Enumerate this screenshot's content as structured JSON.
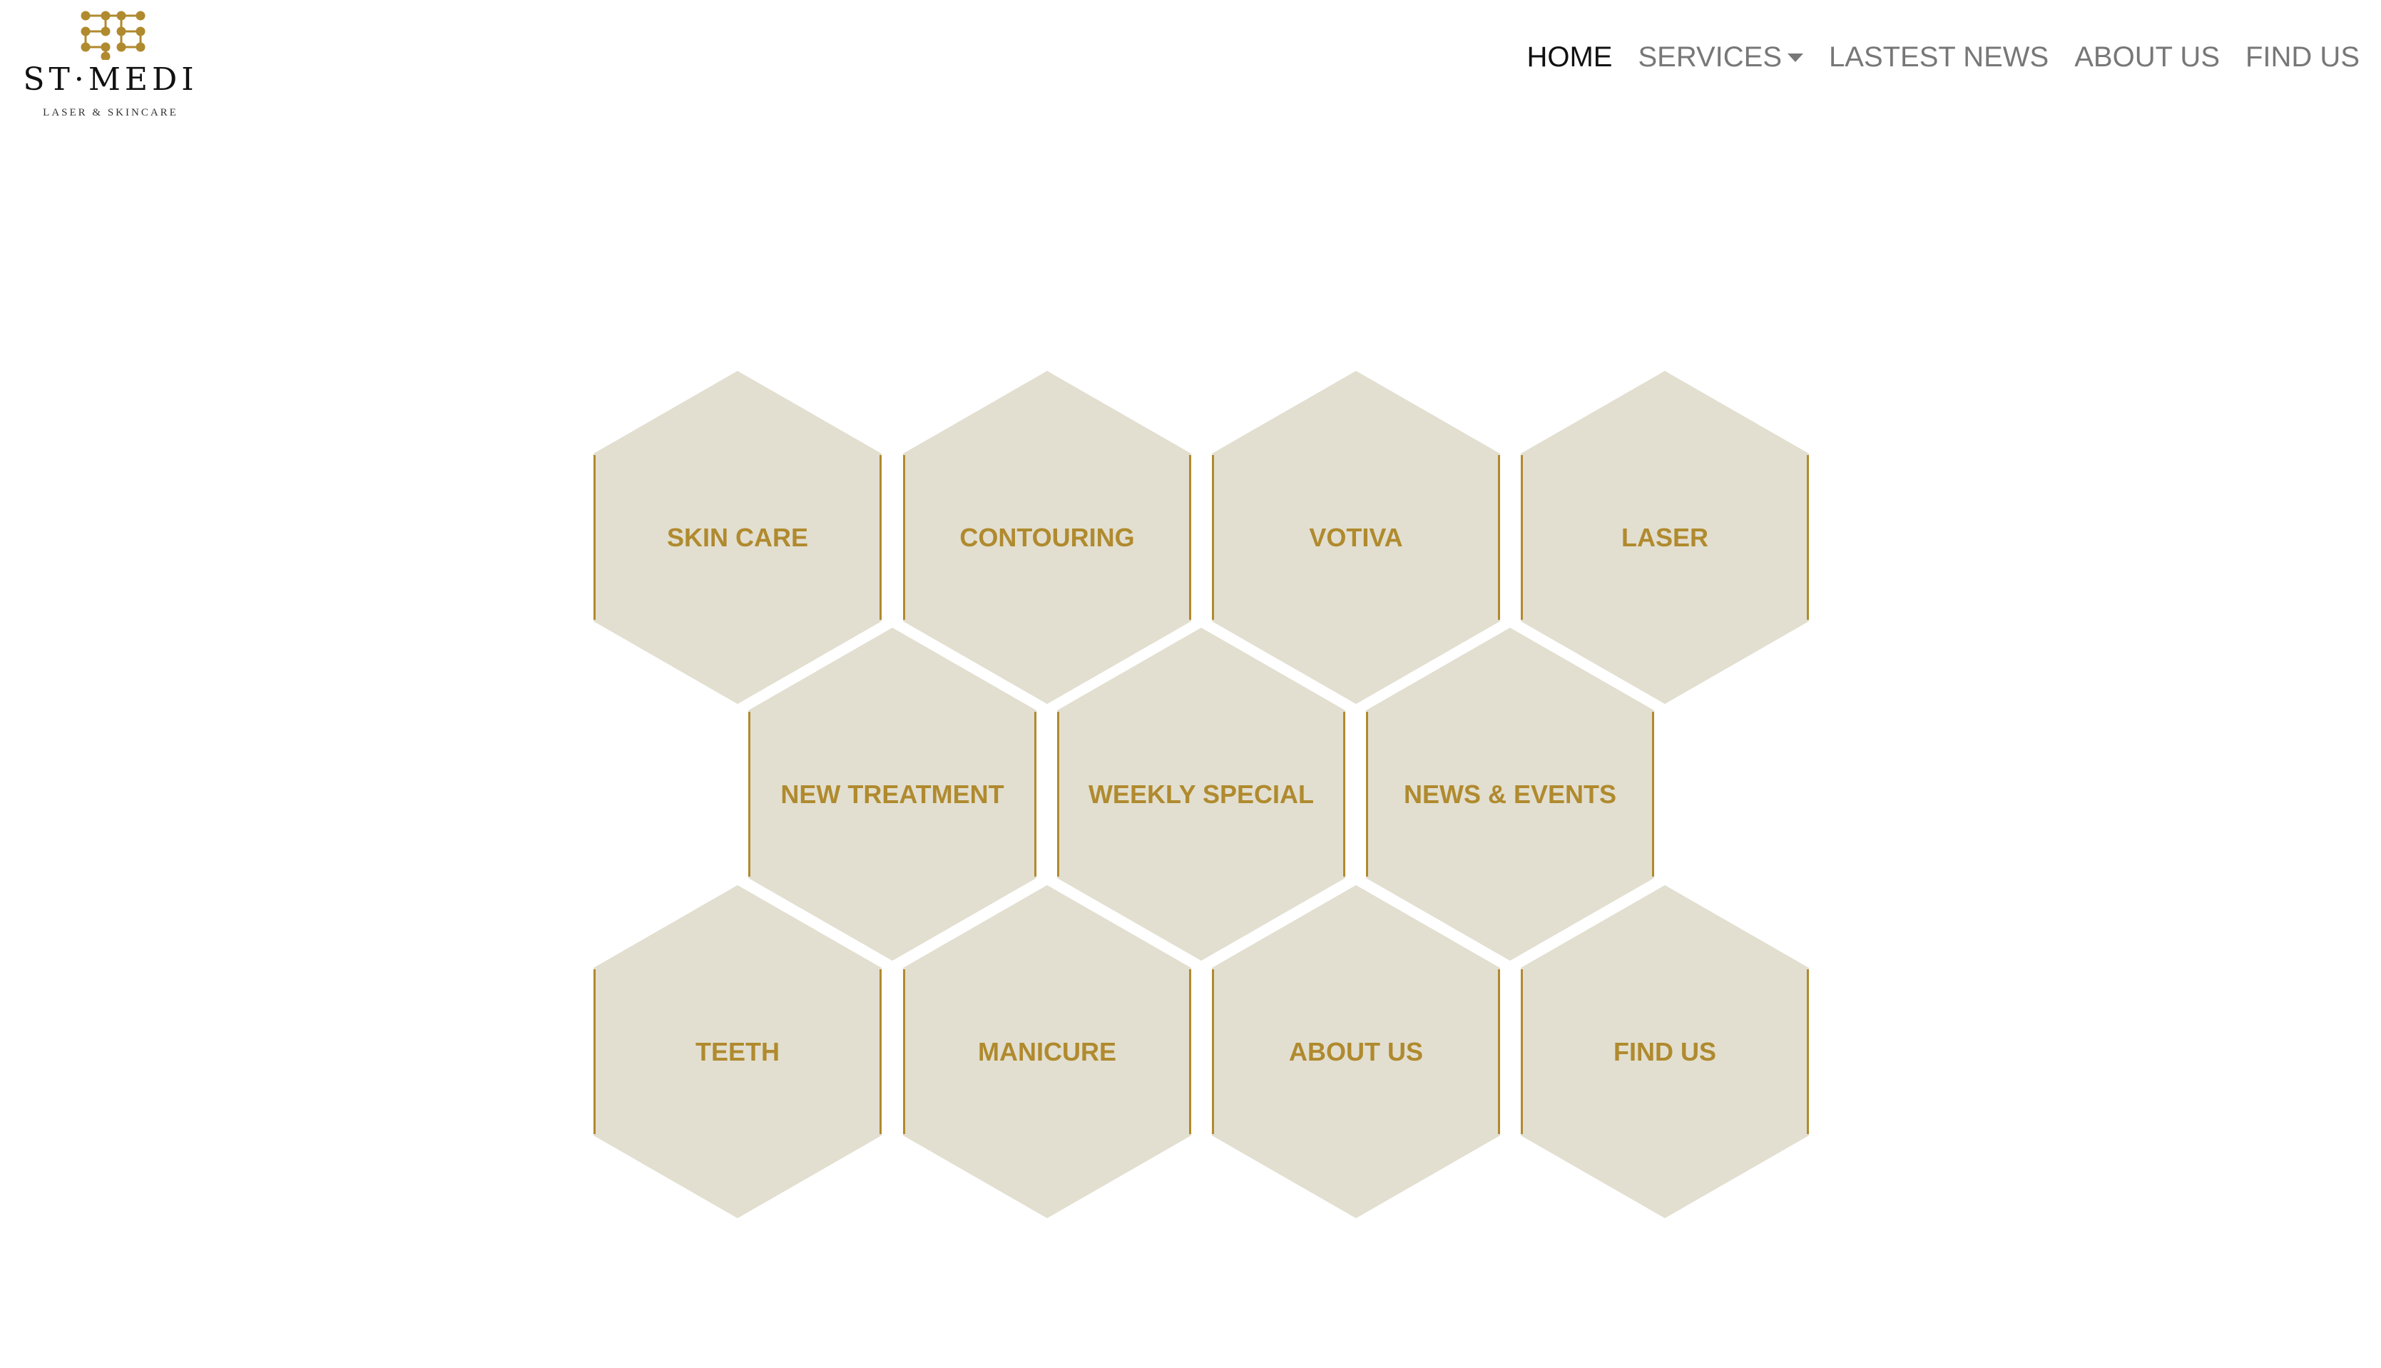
{
  "brand": {
    "name": "ST·MEDI",
    "tagline": "LASER & SKINCARE",
    "logo_icon": "dot-grid-logo-icon",
    "accent_color": "#B08A2E"
  },
  "nav": {
    "items": [
      {
        "label": "HOME",
        "active": true
      },
      {
        "label": "SERVICES",
        "dropdown": true
      },
      {
        "label": "LASTEST NEWS"
      },
      {
        "label": "ABOUT US"
      },
      {
        "label": "FIND US"
      }
    ]
  },
  "tiles": {
    "fill_color": "#E2DFD0",
    "edge_color": "#B08A2E",
    "text_color": "#B08A2E",
    "rows": [
      [
        "SKIN CARE",
        "CONTOURING",
        "VOTIVA",
        "LASER"
      ],
      [
        "NEW TREATMENT",
        "WEEKLY SPECIAL",
        "NEWS & EVENTS"
      ],
      [
        "TEETH",
        "MANICURE",
        "ABOUT US",
        "FIND US"
      ]
    ]
  }
}
